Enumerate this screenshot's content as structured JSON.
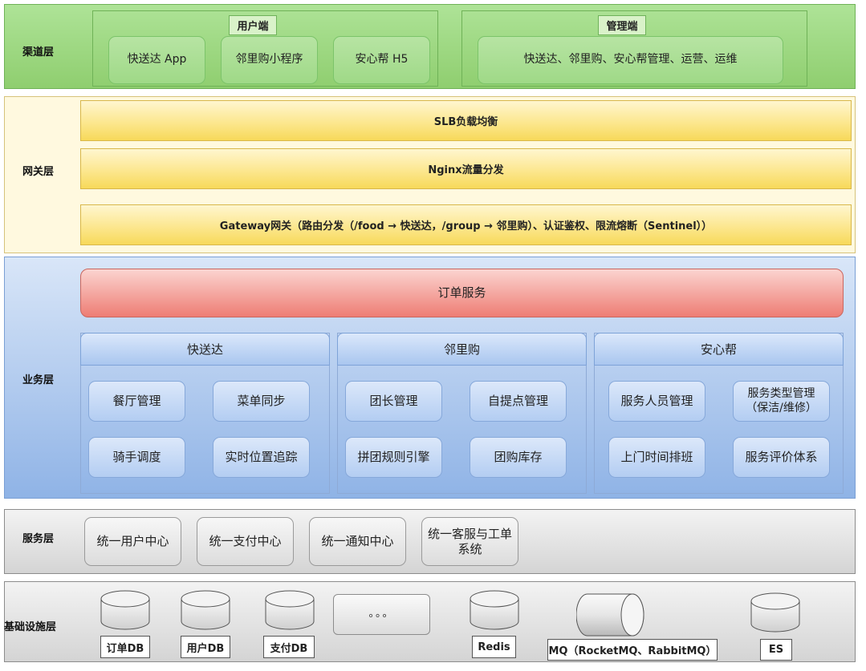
{
  "layers": {
    "channel": "渠道层",
    "gateway": "网关层",
    "business": "业务层",
    "service": "服务层",
    "infra": "基础设施层"
  },
  "channel": {
    "user_side": {
      "title": "用户端",
      "items": [
        "快送达 App",
        "邻里购小程序",
        "安心帮 H5"
      ]
    },
    "admin_side": {
      "title": "管理端",
      "item": "快送达、邻里购、安心帮管理、运营、运维"
    }
  },
  "gateway": {
    "slb": "SLB负载均衡",
    "nginx": "Nginx流量分发",
    "gw": "Gateway网关（路由分发（/food → 快送达，/group → 邻里购）、认证鉴权、限流熔断（Sentinel））"
  },
  "business": {
    "order": "订单服务",
    "domains": [
      {
        "title": "快送达",
        "items": [
          "餐厅管理",
          "菜单同步",
          "骑手调度",
          "实时位置追踪"
        ]
      },
      {
        "title": "邻里购",
        "items": [
          "团长管理",
          "自提点管理",
          "拼团规则引擎",
          "团购库存"
        ]
      },
      {
        "title": "安心帮",
        "items": [
          "服务人员管理",
          "服务类型管理\n（保洁/维修）",
          "上门时间排班",
          "服务评价体系"
        ]
      }
    ]
  },
  "service": {
    "items": [
      "统一用户中心",
      "统一支付中心",
      "统一通知中心",
      "统一客服与工单\n系统"
    ]
  },
  "infra": {
    "order_db": "订单DB",
    "user_db": "用户DB",
    "pay_db": "支付DB",
    "ellipsis": "。。。",
    "redis": "Redis",
    "mq": "MQ（RocketMQ、RabbitMQ）",
    "es": "ES"
  },
  "colors": {
    "channel_bg": "#92d36e",
    "gateway_bg": "#fff8dc",
    "business_bg": "#a9c4ea",
    "service_bg": "#e2e2e2",
    "order_red": "#ee7d74"
  }
}
